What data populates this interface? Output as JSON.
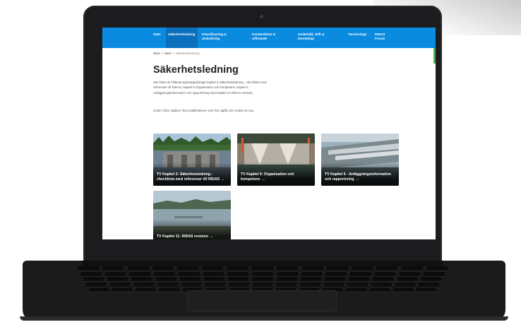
{
  "nav": {
    "items": [
      {
        "id": "start",
        "label": "Start"
      },
      {
        "id": "sakerhetsledning",
        "label": "Säkerhetsledning",
        "active": true
      },
      {
        "id": "klassificering",
        "label": "Klassificering & utvärdering"
      },
      {
        "id": "konstruktion",
        "label": "Konstruktion & utförande"
      },
      {
        "id": "underhall",
        "label": "Underhåll, drift & beredskap"
      },
      {
        "id": "terminologi",
        "label": "Terminologi"
      },
      {
        "id": "forum",
        "label": "RIDAS Forum"
      }
    ]
  },
  "breadcrumb": {
    "items": [
      "Start",
      "Start",
      "Säkerhetsledning"
    ],
    "separator": ">"
  },
  "page": {
    "title": "Säkerhetsledning",
    "intro": "Här hittar du Tillämpningsvägledningar kapitel 2 Säkerhetsledning - checklista med referenser till RIDAS, kapitel 5 Organisation och kompetens, kapitel 6 Anläggningsinformation och rapportering samt kapitel 11 RIDAS revision.",
    "note": "Under Äldre utgåvor finns publikationer som har utgått och ersatts av nya."
  },
  "cards": [
    {
      "label": "TV Kapitel 2: Säkerhetsledning - checklista med referenser till RIDAS",
      "arrow": "→"
    },
    {
      "label": "TV Kapitel 5: Organisation och kompetens",
      "arrow": "→"
    },
    {
      "label": "TV Kapitel 6 - Anläggningsinformation och rapportering",
      "arrow": "→"
    },
    {
      "label": "TV Kapitel 11: RIDAS revision",
      "arrow": "→"
    }
  ],
  "colors": {
    "nav": "#0a8be0",
    "nav_active": "#0a6fbd",
    "accent": "#4caf50",
    "laptop": "#1c1c1e"
  }
}
